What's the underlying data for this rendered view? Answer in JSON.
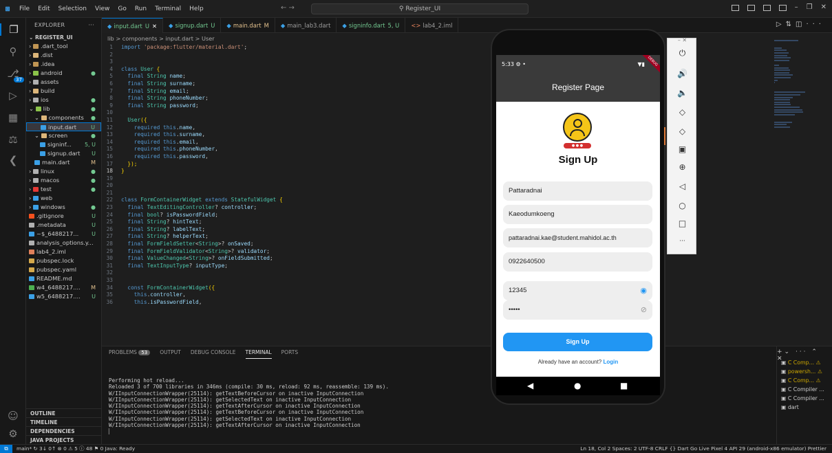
{
  "titlebar": {
    "menu": [
      "File",
      "Edit",
      "Selection",
      "View",
      "Go",
      "Run",
      "Terminal",
      "Help"
    ],
    "search": "Register_UI"
  },
  "explorer": {
    "title": "EXPLORER",
    "project": "REGISTER_UI",
    "items": [
      {
        "label": ".dart_tool",
        "depth": 1,
        "status": "",
        "color": "#c09553"
      },
      {
        "label": ".dist",
        "depth": 1,
        "status": "",
        "color": "#dcb67a"
      },
      {
        "label": ".idea",
        "depth": 1,
        "status": "",
        "color": "#c09553"
      },
      {
        "label": "android",
        "depth": 1,
        "status": "●",
        "color": "#8bc34a"
      },
      {
        "label": "assets",
        "depth": 1,
        "status": "",
        "color": "#b0b0b0"
      },
      {
        "label": "build",
        "depth": 1,
        "status": "",
        "color": "#dcb67a"
      },
      {
        "label": "ios",
        "depth": 1,
        "status": "●",
        "color": "#b0b0b0"
      },
      {
        "label": "lib",
        "depth": 1,
        "status": "●",
        "color": "#8bc34a"
      },
      {
        "label": "components",
        "depth": 2,
        "status": "●",
        "color": "#dcb67a"
      },
      {
        "label": "input.dart",
        "depth": 3,
        "status": "U",
        "color": "#3ba0e6"
      },
      {
        "label": "screen",
        "depth": 2,
        "status": "●",
        "color": "#dcb67a"
      },
      {
        "label": "signinf...",
        "depth": 3,
        "status": "5, U",
        "color": "#3ba0e6"
      },
      {
        "label": "signup.dart",
        "depth": 3,
        "status": "U",
        "color": "#3ba0e6"
      },
      {
        "label": "main.dart",
        "depth": 2,
        "status": "M",
        "color": "#3ba0e6"
      },
      {
        "label": "linux",
        "depth": 1,
        "status": "●",
        "color": "#b0b0b0"
      },
      {
        "label": "macos",
        "depth": 1,
        "status": "●",
        "color": "#b0b0b0"
      },
      {
        "label": "test",
        "depth": 1,
        "status": "●",
        "color": "#e53935"
      },
      {
        "label": "web",
        "depth": 1,
        "status": "",
        "color": "#3ba0e6"
      },
      {
        "label": "windows",
        "depth": 1,
        "status": "●",
        "color": "#3ba0e6"
      },
      {
        "label": ".gitignore",
        "depth": 1,
        "status": "U",
        "color": "#f4511e"
      },
      {
        "label": ".metadata",
        "depth": 1,
        "status": "U",
        "color": "#b0b0b0"
      },
      {
        "label": "~$_6488217...",
        "depth": 1,
        "status": "U",
        "color": "#3ba0e6"
      },
      {
        "label": "analysis_options.y...",
        "depth": 1,
        "status": "",
        "color": "#b0b0b0"
      },
      {
        "label": "lab4_2.iml",
        "depth": 1,
        "status": "",
        "color": "#e0805a"
      },
      {
        "label": "pubspec.lock",
        "depth": 1,
        "status": "",
        "color": "#d4a84b"
      },
      {
        "label": "pubspec.yaml",
        "depth": 1,
        "status": "",
        "color": "#d4a84b"
      },
      {
        "label": "README.md",
        "depth": 1,
        "status": "",
        "color": "#3ba0e6"
      },
      {
        "label": "w4_6488217....",
        "depth": 1,
        "status": "M",
        "color": "#4caf50"
      },
      {
        "label": "w5_6488217....",
        "depth": 1,
        "status": "U",
        "color": "#3ba0e6"
      }
    ],
    "bottom": [
      "OUTLINE",
      "TIMELINE",
      "DEPENDENCIES",
      "JAVA PROJECTS"
    ]
  },
  "tabs": [
    {
      "label": "input.dart",
      "status": "U",
      "active": true
    },
    {
      "label": "signup.dart",
      "status": "U",
      "active": false
    },
    {
      "label": "main.dart",
      "status": "M",
      "active": false
    },
    {
      "label": "main_lab3.dart",
      "status": "",
      "active": false
    },
    {
      "label": "signinfo.dart",
      "status": "5, U",
      "active": false
    },
    {
      "label": "lab4_2.iml",
      "status": "",
      "active": false
    }
  ],
  "breadcrumb": "lib > components > input.dart > User",
  "code": [
    {
      "n": "1",
      "t": "import 'package:flutter/material.dart';"
    },
    {
      "n": "2",
      "t": ""
    },
    {
      "n": "3",
      "t": ""
    },
    {
      "n": "4",
      "t": "class User {"
    },
    {
      "n": "5",
      "t": "  final String name;"
    },
    {
      "n": "6",
      "t": "  final String surname;"
    },
    {
      "n": "7",
      "t": "  final String email;"
    },
    {
      "n": "8",
      "t": "  final String phoneNumber;"
    },
    {
      "n": "9",
      "t": "  final String password;"
    },
    {
      "n": "10",
      "t": ""
    },
    {
      "n": "11",
      "t": "  User({"
    },
    {
      "n": "12",
      "t": "    required this.name,"
    },
    {
      "n": "13",
      "t": "    required this.surname,"
    },
    {
      "n": "14",
      "t": "    required this.email,"
    },
    {
      "n": "15",
      "t": "    required this.phoneNumber,"
    },
    {
      "n": "16",
      "t": "    required this.password,"
    },
    {
      "n": "17",
      "t": "  });"
    },
    {
      "n": "18",
      "t": "}"
    },
    {
      "n": "19",
      "t": ""
    },
    {
      "n": "20",
      "t": ""
    },
    {
      "n": "21",
      "t": ""
    },
    {
      "n": "22",
      "t": "class FormContainerWidget extends StatefulWidget {"
    },
    {
      "n": "23",
      "t": "  final TextEditingController? controller;"
    },
    {
      "n": "24",
      "t": "  final bool? isPasswordField;"
    },
    {
      "n": "25",
      "t": "  final String? hintText;"
    },
    {
      "n": "26",
      "t": "  final String? labelText;"
    },
    {
      "n": "27",
      "t": "  final String? helperText;"
    },
    {
      "n": "28",
      "t": "  final FormFieldSetter<String>? onSaved;"
    },
    {
      "n": "29",
      "t": "  final FormFieldValidator<String>? validator;"
    },
    {
      "n": "30",
      "t": "  final ValueChanged<String>? onFieldSubmitted;"
    },
    {
      "n": "31",
      "t": "  final TextInputType? inputType;"
    },
    {
      "n": "32",
      "t": ""
    },
    {
      "n": "33",
      "t": ""
    },
    {
      "n": "34",
      "t": "  const FormContainerWidget({"
    },
    {
      "n": "35",
      "t": "    this.controller,"
    },
    {
      "n": "36",
      "t": "    this.isPasswordField,"
    }
  ],
  "panel": {
    "tabs": [
      "PROBLEMS",
      "OUTPUT",
      "DEBUG CONSOLE",
      "TERMINAL",
      "PORTS"
    ],
    "problems_count": "53",
    "terminal_lines": [
      "Performing hot reload...",
      "Reloaded 3 of 700 libraries in 346ms (compile: 30 ms, reload: 92 ms, reassemble: 139 ms).",
      "W/IInputConnectionWrapper(25114): getTextBeforeCursor on inactive InputConnection",
      "W/IInputConnectionWrapper(25114): getSelectedText on inactive InputConnection",
      "W/IInputConnectionWrapper(25114): getTextAfterCursor on inactive InputConnection",
      "W/IInputConnectionWrapper(25114): getTextBeforeCursor on inactive InputConnection",
      "W/IInputConnectionWrapper(25114): getSelectedText on inactive InputConnection",
      "W/IInputConnectionWrapper(25114): getTextAfterCursor on inactive InputConnection"
    ],
    "terminals": [
      "C Comp...",
      "powersh...",
      "C Comp...",
      "C Compiler ...",
      "C Compiler ...",
      "dart"
    ]
  },
  "statusbar": {
    "left": "main*  ↻ 3↓ 0↑  ⊗ 0 ⚠ 5 ⓘ 48   ⚑ 0   Java: Ready",
    "right": "Ln 18, Col 2   Spaces: 2   UTF-8   CRLF   {} Dart   Go Live   Pixel 4 API 29 (android-x86 emulator)   Prettier"
  },
  "phone": {
    "time": "5:33",
    "debug": "DEBUG",
    "appbar_title": "Register Page",
    "heading": "Sign Up",
    "fields": {
      "name": "Pattaradnai",
      "surname": "Kaeodumkoeng",
      "email": "pattaradnai.kae@student.mahidol.ac.th",
      "phone": "0922640500",
      "password_visible": "12345",
      "password_hidden": "•••••"
    },
    "button": "Sign Up",
    "login_prompt": "Already have an account?",
    "login_link": "Login"
  },
  "colors": {
    "accent": "#0078d4",
    "appbar": "#3a3a3a",
    "button": "#2196f3",
    "avatar": "#f5c518"
  }
}
